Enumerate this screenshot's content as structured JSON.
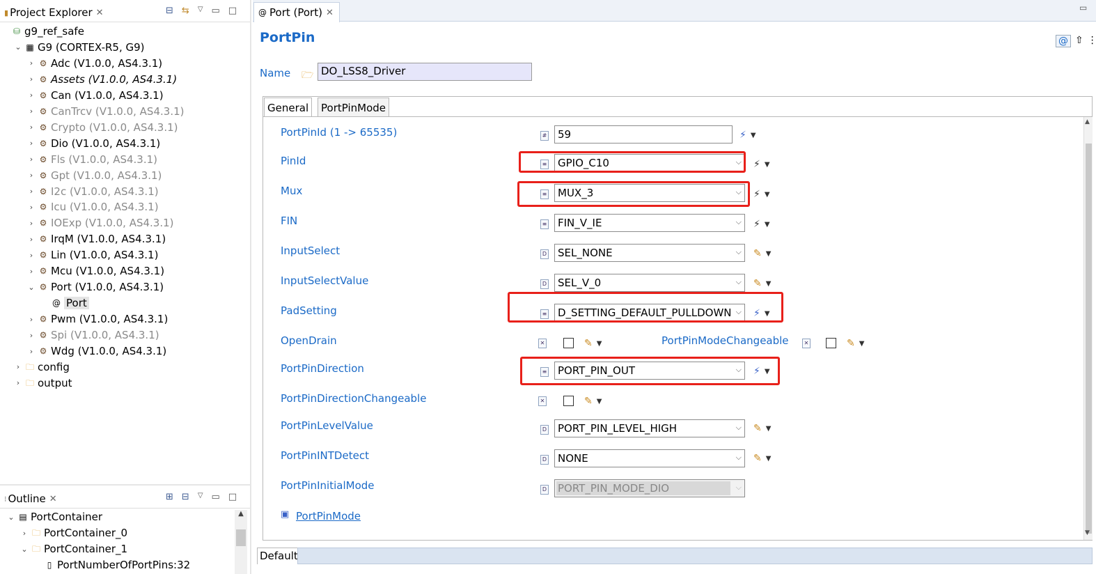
{
  "project_explorer": {
    "title": "Project Explorer",
    "tree": [
      {
        "label": "g9_ref_safe",
        "icon": "project-icon",
        "level": 0,
        "expand": ""
      },
      {
        "label": "G9 (CORTEX-R5, G9)",
        "icon": "chip-icon",
        "level": 1,
        "expand": "open"
      },
      {
        "label": "Adc (V1.0.0, AS4.3.1)",
        "icon": "module-icon",
        "level": 2,
        "expand": "closed",
        "style": ""
      },
      {
        "label": "Assets (V1.0.0, AS4.3.1)",
        "icon": "module-icon",
        "level": 2,
        "expand": "closed",
        "style": "italic"
      },
      {
        "label": "Can (V1.0.0, AS4.3.1)",
        "icon": "module-icon",
        "level": 2,
        "expand": "closed",
        "style": ""
      },
      {
        "label": "CanTrcv (V1.0.0, AS4.3.1)",
        "icon": "module-icon",
        "level": 2,
        "expand": "closed",
        "style": "gray"
      },
      {
        "label": "Crypto (V1.0.0, AS4.3.1)",
        "icon": "module-icon",
        "level": 2,
        "expand": "closed",
        "style": "gray"
      },
      {
        "label": "Dio (V1.0.0, AS4.3.1)",
        "icon": "module-icon",
        "level": 2,
        "expand": "closed",
        "style": ""
      },
      {
        "label": "Fls (V1.0.0, AS4.3.1)",
        "icon": "module-icon",
        "level": 2,
        "expand": "closed",
        "style": "gray"
      },
      {
        "label": "Gpt (V1.0.0, AS4.3.1)",
        "icon": "module-icon",
        "level": 2,
        "expand": "closed",
        "style": "gray"
      },
      {
        "label": "I2c (V1.0.0, AS4.3.1)",
        "icon": "module-icon",
        "level": 2,
        "expand": "closed",
        "style": "gray"
      },
      {
        "label": "Icu (V1.0.0, AS4.3.1)",
        "icon": "module-icon",
        "level": 2,
        "expand": "closed",
        "style": "gray"
      },
      {
        "label": "IOExp (V1.0.0, AS4.3.1)",
        "icon": "module-icon",
        "level": 2,
        "expand": "closed",
        "style": "gray"
      },
      {
        "label": "IrqM (V1.0.0, AS4.3.1)",
        "icon": "module-icon",
        "level": 2,
        "expand": "closed",
        "style": ""
      },
      {
        "label": "Lin (V1.0.0, AS4.3.1)",
        "icon": "module-icon",
        "level": 2,
        "expand": "closed",
        "style": ""
      },
      {
        "label": "Mcu (V1.0.0, AS4.3.1)",
        "icon": "module-icon",
        "level": 2,
        "expand": "closed",
        "style": ""
      },
      {
        "label": "Port (V1.0.0, AS4.3.1)",
        "icon": "module-icon",
        "level": 2,
        "expand": "open",
        "style": ""
      },
      {
        "label": "Port",
        "icon": "config-icon",
        "level": 3,
        "expand": "",
        "style": "selected"
      },
      {
        "label": "Pwm (V1.0.0, AS4.3.1)",
        "icon": "module-icon",
        "level": 2,
        "expand": "closed",
        "style": ""
      },
      {
        "label": "Spi (V1.0.0, AS4.3.1)",
        "icon": "module-icon",
        "level": 2,
        "expand": "closed",
        "style": "gray"
      },
      {
        "label": "Wdg (V1.0.0, AS4.3.1)",
        "icon": "module-icon",
        "level": 2,
        "expand": "closed",
        "style": ""
      },
      {
        "label": "config",
        "icon": "folder-icon",
        "level": 1,
        "expand": "closed",
        "style": ""
      },
      {
        "label": "output",
        "icon": "folder-icon",
        "level": 1,
        "expand": "closed",
        "style": ""
      }
    ]
  },
  "outline": {
    "title": "Outline",
    "tree": [
      {
        "label": "PortContainer",
        "icon": "table-icon",
        "level": 0,
        "expand": "open"
      },
      {
        "label": "PortContainer_0",
        "icon": "folder-icon",
        "level": 1,
        "expand": "closed"
      },
      {
        "label": "PortContainer_1",
        "icon": "folder-icon",
        "level": 1,
        "expand": "open"
      },
      {
        "label": "PortNumberOfPortPins:32",
        "icon": "param-icon",
        "level": 2,
        "expand": ""
      }
    ]
  },
  "editor": {
    "tab_label": "Port (Port)",
    "title": "PortPin",
    "name_label": "Name",
    "name_value": "DO_LSS8_Driver",
    "subtabs": [
      "General",
      "PortPinMode"
    ],
    "fields": {
      "portpinid": {
        "label": "PortPinId (1 -> 65535)",
        "value": "59"
      },
      "pinid": {
        "label": "PinId",
        "value": "GPIO_C10"
      },
      "mux": {
        "label": "Mux",
        "value": "MUX_3"
      },
      "fin": {
        "label": "FIN",
        "value": "FIN_V_IE"
      },
      "inputselect": {
        "label": "InputSelect",
        "value": "SEL_NONE"
      },
      "inputselectvalue": {
        "label": "InputSelectValue",
        "value": "SEL_V_0"
      },
      "padsetting": {
        "label": "PadSetting",
        "value": "D_SETTING_DEFAULT_PULLDOWN"
      },
      "opendrain": {
        "label": "OpenDrain",
        "checked": false
      },
      "portpinmodechangeable": {
        "label": "PortPinModeChangeable",
        "checked": false
      },
      "portpindirection": {
        "label": "PortPinDirection",
        "value": "PORT_PIN_OUT"
      },
      "portpindirectionchangeable": {
        "label": "PortPinDirectionChangeable",
        "checked": false
      },
      "portpinlevelvalue": {
        "label": "PortPinLevelValue",
        "value": "PORT_PIN_LEVEL_HIGH"
      },
      "portpinintdetect": {
        "label": "PortPinINTDetect",
        "value": "NONE"
      },
      "portpininitialmode": {
        "label": "PortPinInitialMode",
        "value": "PORT_PIN_MODE_DIO"
      }
    },
    "link_label": "PortPinMode",
    "bottom_tab": "Default"
  },
  "colors": {
    "label_blue": "#1b6ac7",
    "highlight_red": "#e8201a",
    "name_bg": "#e6e6fa"
  }
}
